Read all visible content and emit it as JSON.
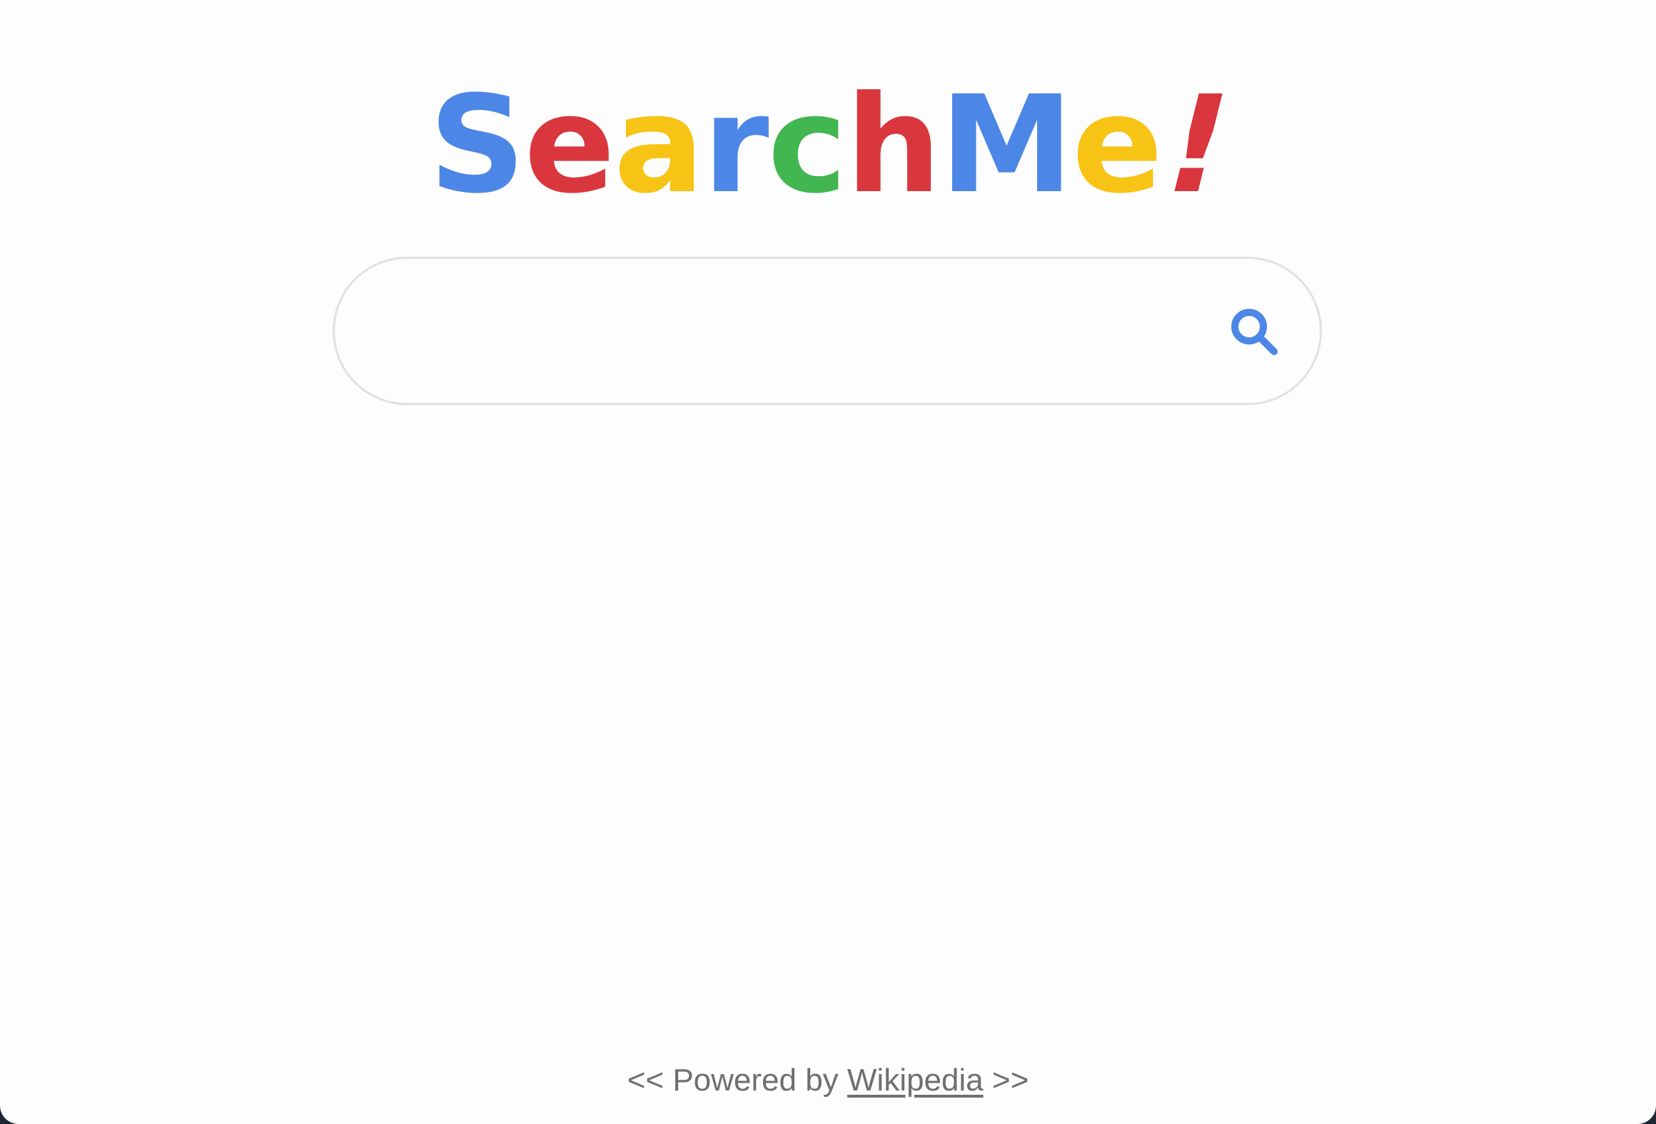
{
  "logo": {
    "letters": [
      {
        "char": "S",
        "color": "#4c86e6"
      },
      {
        "char": "e",
        "color": "#d9363e"
      },
      {
        "char": "a",
        "color": "#f7c314"
      },
      {
        "char": "r",
        "color": "#4c86e6"
      },
      {
        "char": "c",
        "color": "#42b650"
      },
      {
        "char": "h",
        "color": "#d9363e"
      },
      {
        "char": "M",
        "color": "#4c86e6"
      },
      {
        "char": "e",
        "color": "#f7c314"
      },
      {
        "char": "!",
        "color": "#d9363e"
      }
    ]
  },
  "search": {
    "value": "",
    "placeholder": "",
    "icon": "search-icon",
    "icon_color": "#4c86e6"
  },
  "footer": {
    "prefix": "<< Powered by ",
    "link_label": "Wikipedia",
    "suffix": " >>"
  }
}
